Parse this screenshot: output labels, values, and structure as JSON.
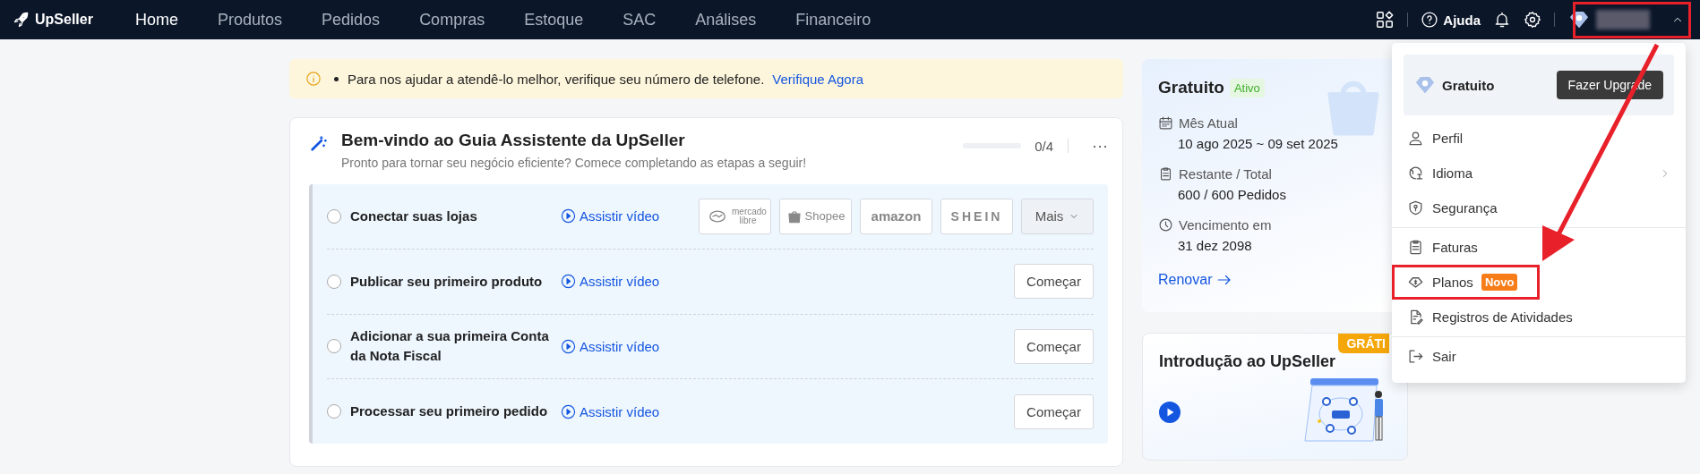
{
  "nav": {
    "logo": "UpSeller",
    "items": [
      {
        "label": "Home",
        "selected": true
      },
      {
        "label": "Produtos",
        "selected": false
      },
      {
        "label": "Pedidos",
        "selected": false
      },
      {
        "label": "Compras",
        "selected": false
      },
      {
        "label": "Estoque",
        "selected": false
      },
      {
        "label": "SAC",
        "selected": false
      },
      {
        "label": "Análises",
        "selected": false
      },
      {
        "label": "Financeiro",
        "selected": false
      }
    ],
    "help": "Ajuda",
    "account_expanded": true
  },
  "alert": {
    "text": "Para nos ajudar a atendê-lo melhor, verifique seu número de telefone.",
    "link": "Verifique Agora"
  },
  "guide": {
    "title": "Bem-vindo ao Guia Assistente da UpSeller",
    "subtitle": "Pronto para tornar seu negócio eficiente? Comece completando as etapas a seguir!",
    "progress": {
      "level": 0,
      "reading": "0/4"
    },
    "more": "⋯",
    "steps": [
      {
        "kind": "platforms",
        "label": "Conectar suas lojas",
        "checked": false,
        "video": "Assistir vídeo",
        "platforms": [
          {
            "kind": "mercado",
            "label": "mercado libre"
          },
          {
            "kind": "shopee",
            "label": "Shopee"
          },
          {
            "kind": "amazon",
            "label": "amazon"
          },
          {
            "kind": "shein",
            "label": "SHEIN"
          }
        ],
        "more": "Mais"
      },
      {
        "kind": "action",
        "label": "Publicar seu primeiro produto",
        "checked": false,
        "video": "Assistir vídeo",
        "action": "Começar"
      },
      {
        "kind": "action",
        "label": "Adicionar a sua primeira Conta da Nota Fiscal",
        "checked": false,
        "video": "Assistir vídeo",
        "action": "Começar"
      },
      {
        "kind": "action",
        "label": "Processar seu primeiro pedido",
        "checked": false,
        "video": "Assistir vídeo",
        "action": "Começar"
      }
    ]
  },
  "plan": {
    "title": "Gratuito",
    "status": "Ativo",
    "items": [
      {
        "kind": "calendar",
        "label": "Mês Atual",
        "value": "10 ago 2025 ~ 09 set 2025"
      },
      {
        "kind": "clipboard",
        "label": "Restante / Total",
        "value": "600 / 600 Pedidos"
      },
      {
        "kind": "clock",
        "label": "Vencimento em",
        "value": "31 dez 2098"
      }
    ],
    "link": "Renovar"
  },
  "intro": {
    "title": "Introdução ao UpSeller",
    "badge": "GRÁTI"
  },
  "menu": {
    "plan": "Gratuito",
    "upgrade": "Fazer Upgrade",
    "groups": [
      [
        {
          "kind": "user",
          "label": "Perfil"
        },
        {
          "kind": "globe",
          "label": "Idioma",
          "submenu": true
        },
        {
          "kind": "shield",
          "label": "Segurança"
        }
      ],
      [
        {
          "kind": "clipboard",
          "label": "Faturas"
        },
        {
          "kind": "tag",
          "label": "Planos",
          "badge": "Novo",
          "highlighted": true
        },
        {
          "kind": "log",
          "label": "Registros de Atividades"
        }
      ],
      [
        {
          "kind": "logout",
          "label": "Sair"
        }
      ]
    ]
  }
}
